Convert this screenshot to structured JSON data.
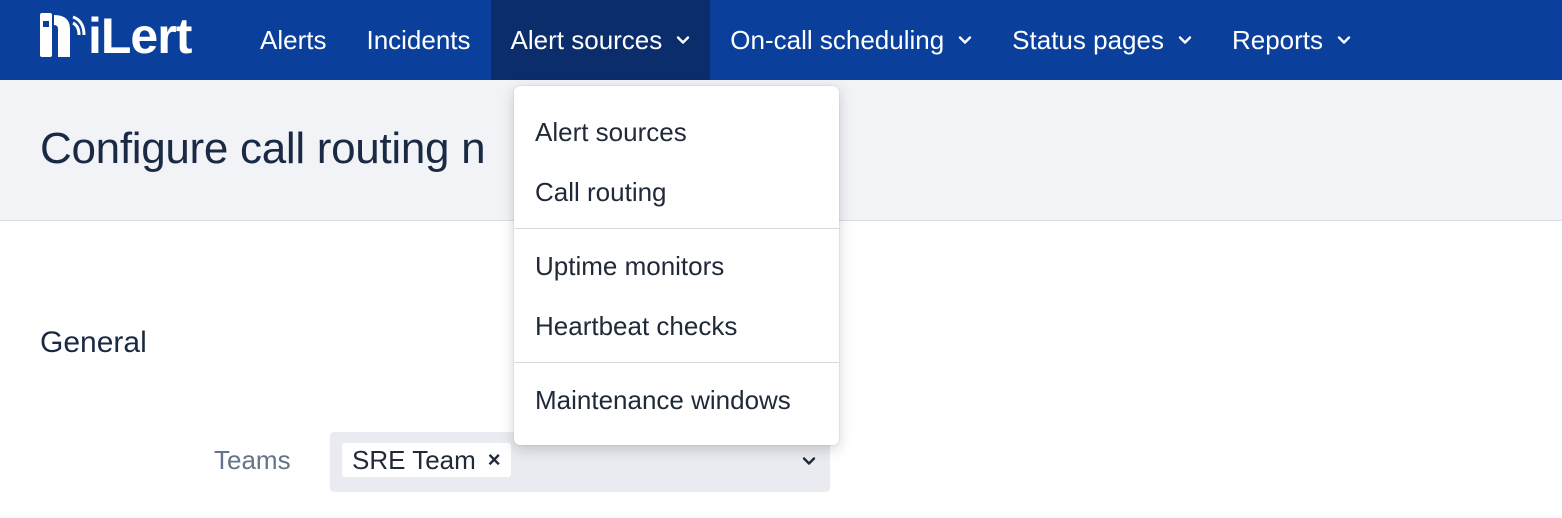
{
  "brand": {
    "name": "iLert"
  },
  "nav": {
    "items": [
      {
        "label": "Alerts",
        "has_dropdown": false,
        "active": false
      },
      {
        "label": "Incidents",
        "has_dropdown": false,
        "active": false
      },
      {
        "label": "Alert sources",
        "has_dropdown": true,
        "active": true
      },
      {
        "label": "On-call scheduling",
        "has_dropdown": true,
        "active": false
      },
      {
        "label": "Status pages",
        "has_dropdown": true,
        "active": false
      },
      {
        "label": "Reports",
        "has_dropdown": true,
        "active": false
      }
    ]
  },
  "dropdown": {
    "items": [
      {
        "label": "Alert sources"
      },
      {
        "label": "Call routing"
      },
      {
        "label": "Uptime monitors"
      },
      {
        "label": "Heartbeat checks"
      },
      {
        "label": "Maintenance windows"
      }
    ]
  },
  "page": {
    "title": "Configure call routing n"
  },
  "form": {
    "section_title": "General",
    "teams": {
      "label": "Teams",
      "selected": [
        "SRE Team"
      ],
      "remove_glyph": "×"
    }
  },
  "colors": {
    "navbar": "#0a3f9c",
    "navbar_active": "#0b2d6b",
    "header_bg": "#f1f3f7",
    "select_bg": "#e9ebf0"
  },
  "icons": {
    "chevron": "chevron-down-icon",
    "logo": "ilert-logo-icon"
  }
}
